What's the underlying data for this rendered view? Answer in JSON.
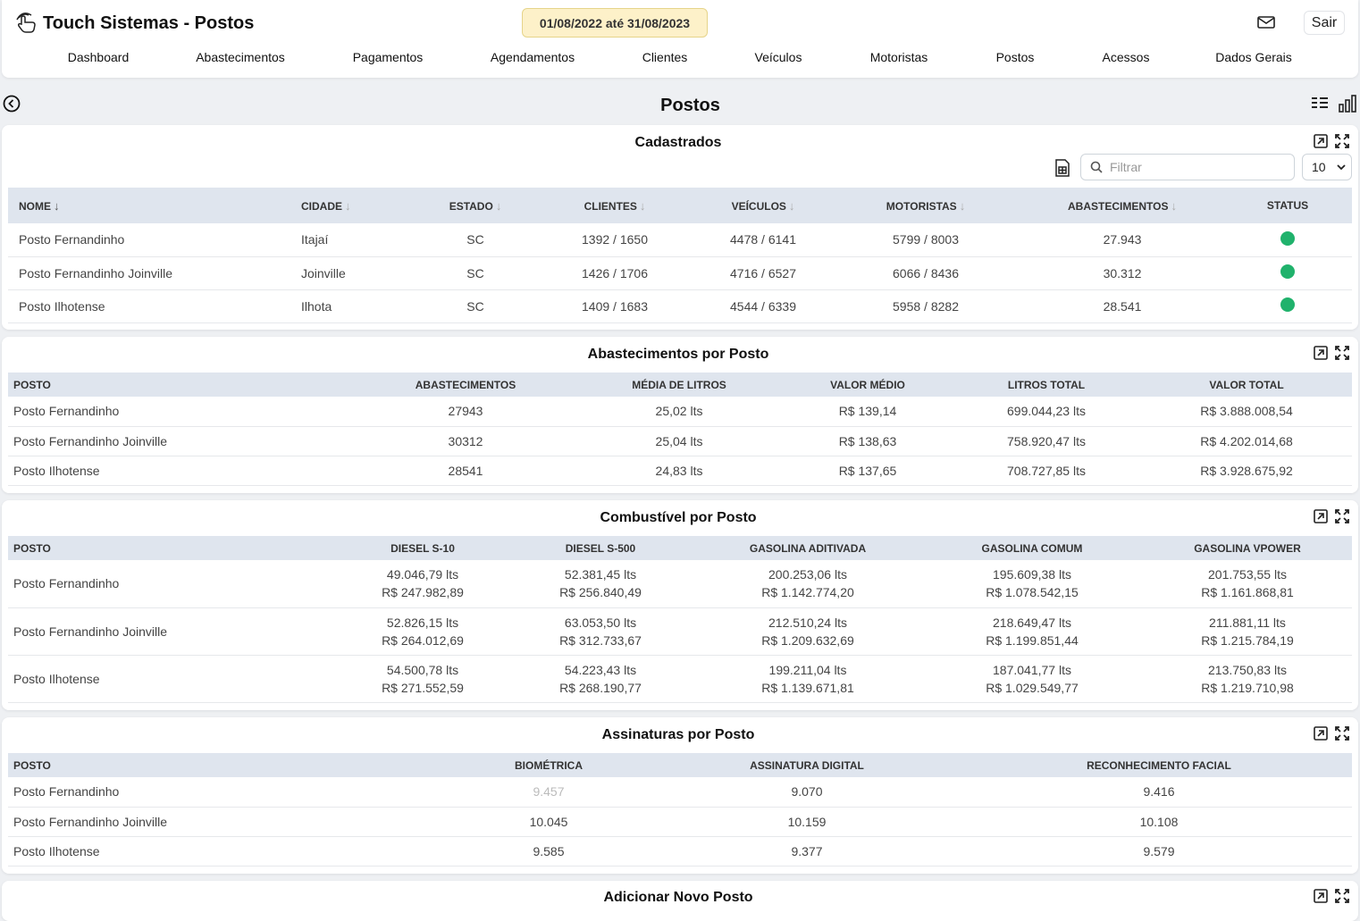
{
  "app": {
    "title": "Touch Sistemas - Postos",
    "date_range": "01/08/2022 até 31/08/2023",
    "logout_label": "Sair"
  },
  "nav": [
    "Dashboard",
    "Abastecimentos",
    "Pagamentos",
    "Agendamentos",
    "Clientes",
    "Veículos",
    "Motoristas",
    "Postos",
    "Acessos",
    "Dados Gerais"
  ],
  "page": {
    "title": "Postos"
  },
  "cadastrados": {
    "title": "Cadastrados",
    "filter_placeholder": "Filtrar",
    "page_size": "10",
    "columns": [
      "NOME",
      "CIDADE",
      "ESTADO",
      "CLIENTES",
      "VEÍCULOS",
      "MOTORISTAS",
      "ABASTECIMENTOS",
      "STATUS"
    ],
    "rows": [
      {
        "nome": "Posto Fernandinho",
        "cidade": "Itajaí",
        "estado": "SC",
        "clientes": "1392 / 1650",
        "veiculos": "4478 / 6141",
        "motoristas": "5799 / 8003",
        "abastecimentos": "27.943",
        "status_color": "#20b26c"
      },
      {
        "nome": "Posto Fernandinho Joinville",
        "cidade": "Joinville",
        "estado": "SC",
        "clientes": "1426 / 1706",
        "veiculos": "4716 / 6527",
        "motoristas": "6066 / 8436",
        "abastecimentos": "30.312",
        "status_color": "#20b26c"
      },
      {
        "nome": "Posto Ilhotense",
        "cidade": "Ilhota",
        "estado": "SC",
        "clientes": "1409 / 1683",
        "veiculos": "4544 / 6339",
        "motoristas": "5958 / 8282",
        "abastecimentos": "28.541",
        "status_color": "#20b26c"
      }
    ]
  },
  "abastecimentos": {
    "title": "Abastecimentos por Posto",
    "columns": [
      "POSTO",
      "ABASTECIMENTOS",
      "MÉDIA DE LITROS",
      "VALOR MÉDIO",
      "LITROS TOTAL",
      "VALOR TOTAL"
    ],
    "rows": [
      {
        "posto": "Posto Fernandinho",
        "abastecimentos": "27943",
        "media_litros": "25,02 lts",
        "valor_medio": "R$ 139,14",
        "litros_total": "699.044,23 lts",
        "valor_total": "R$ 3.888.008,54"
      },
      {
        "posto": "Posto Fernandinho Joinville",
        "abastecimentos": "30312",
        "media_litros": "25,04 lts",
        "valor_medio": "R$ 138,63",
        "litros_total": "758.920,47 lts",
        "valor_total": "R$ 4.202.014,68"
      },
      {
        "posto": "Posto Ilhotense",
        "abastecimentos": "28541",
        "media_litros": "24,83 lts",
        "valor_medio": "R$ 137,65",
        "litros_total": "708.727,85 lts",
        "valor_total": "R$ 3.928.675,92"
      }
    ]
  },
  "combustivel": {
    "title": "Combustível por Posto",
    "columns": [
      "POSTO",
      "DIESEL S-10",
      "DIESEL S-500",
      "GASOLINA ADITIVADA",
      "GASOLINA COMUM",
      "GASOLINA VPOWER"
    ],
    "rows": [
      {
        "posto": "Posto Fernandinho",
        "cells": [
          [
            "49.046,79 lts",
            "R$ 247.982,89"
          ],
          [
            "52.381,45 lts",
            "R$ 256.840,49"
          ],
          [
            "200.253,06 lts",
            "R$ 1.142.774,20"
          ],
          [
            "195.609,38 lts",
            "R$ 1.078.542,15"
          ],
          [
            "201.753,55 lts",
            "R$ 1.161.868,81"
          ]
        ]
      },
      {
        "posto": "Posto Fernandinho Joinville",
        "cells": [
          [
            "52.826,15 lts",
            "R$ 264.012,69"
          ],
          [
            "63.053,50 lts",
            "R$ 312.733,67"
          ],
          [
            "212.510,24 lts",
            "R$ 1.209.632,69"
          ],
          [
            "218.649,47 lts",
            "R$ 1.199.851,44"
          ],
          [
            "211.881,11 lts",
            "R$ 1.215.784,19"
          ]
        ]
      },
      {
        "posto": "Posto Ilhotense",
        "cells": [
          [
            "54.500,78 lts",
            "R$ 271.552,59"
          ],
          [
            "54.223,43 lts",
            "R$ 268.190,77"
          ],
          [
            "199.211,04 lts",
            "R$ 1.139.671,81"
          ],
          [
            "187.041,77 lts",
            "R$ 1.029.549,77"
          ],
          [
            "213.750,83 lts",
            "R$ 1.219.710,98"
          ]
        ]
      }
    ]
  },
  "assinaturas": {
    "title": "Assinaturas por Posto",
    "columns": [
      "POSTO",
      "BIOMÉTRICA",
      "ASSINATURA DIGITAL",
      "RECONHECIMENTO FACIAL"
    ],
    "rows": [
      {
        "posto": "Posto Fernandinho",
        "biometrica": "9.457",
        "digital": "9.070",
        "facial": "9.416"
      },
      {
        "posto": "Posto Fernandinho Joinville",
        "biometrica": "10.045",
        "digital": "10.159",
        "facial": "10.108"
      },
      {
        "posto": "Posto Ilhotense",
        "biometrica": "9.585",
        "digital": "9.377",
        "facial": "9.579"
      }
    ]
  },
  "novo_posto": {
    "title": "Adicionar Novo Posto"
  },
  "icons": {
    "brand": "touch-hand-icon",
    "mail": "envelope-icon",
    "back": "back-arrow-icon",
    "list": "list-view-icon",
    "chart": "bar-chart-icon",
    "expand": "external-expand-icon",
    "fullscreen": "fullscreen-icon",
    "export": "spreadsheet-export-icon",
    "search": "search-icon"
  }
}
